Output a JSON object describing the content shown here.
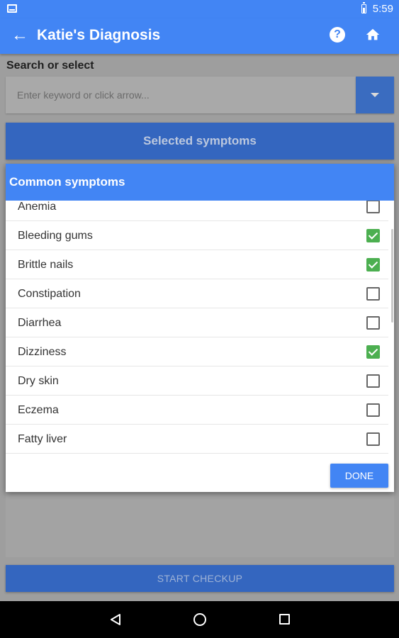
{
  "status_bar": {
    "time": "5:59"
  },
  "app_bar": {
    "title": "Katie's Diagnosis",
    "help_glyph": "?"
  },
  "search": {
    "label": "Search or select",
    "placeholder": "Enter keyword or click arrow..."
  },
  "selected_symptoms_label": "Selected symptoms",
  "dialog": {
    "title": "Common symptoms",
    "items": [
      {
        "label": "Anemia",
        "checked": false
      },
      {
        "label": "Bleeding gums",
        "checked": true
      },
      {
        "label": "Brittle nails",
        "checked": true
      },
      {
        "label": "Constipation",
        "checked": false
      },
      {
        "label": "Diarrhea",
        "checked": false
      },
      {
        "label": "Dizziness",
        "checked": true
      },
      {
        "label": "Dry skin",
        "checked": false
      },
      {
        "label": "Eczema",
        "checked": false
      },
      {
        "label": "Fatty liver",
        "checked": false
      }
    ],
    "done_label": "DONE"
  },
  "start_checkup_label": "START CHECKUP",
  "icons": {
    "back": "arrow-left-icon",
    "help": "help-circle-icon",
    "home": "home-icon",
    "dropdown": "caret-down-icon",
    "nav_back": "triangle-back-icon",
    "nav_home": "circle-home-icon",
    "nav_recent": "square-recent-icon"
  },
  "colors": {
    "primary": "#4285f4",
    "primary_dark": "#3466bf",
    "check": "#4caf50"
  }
}
